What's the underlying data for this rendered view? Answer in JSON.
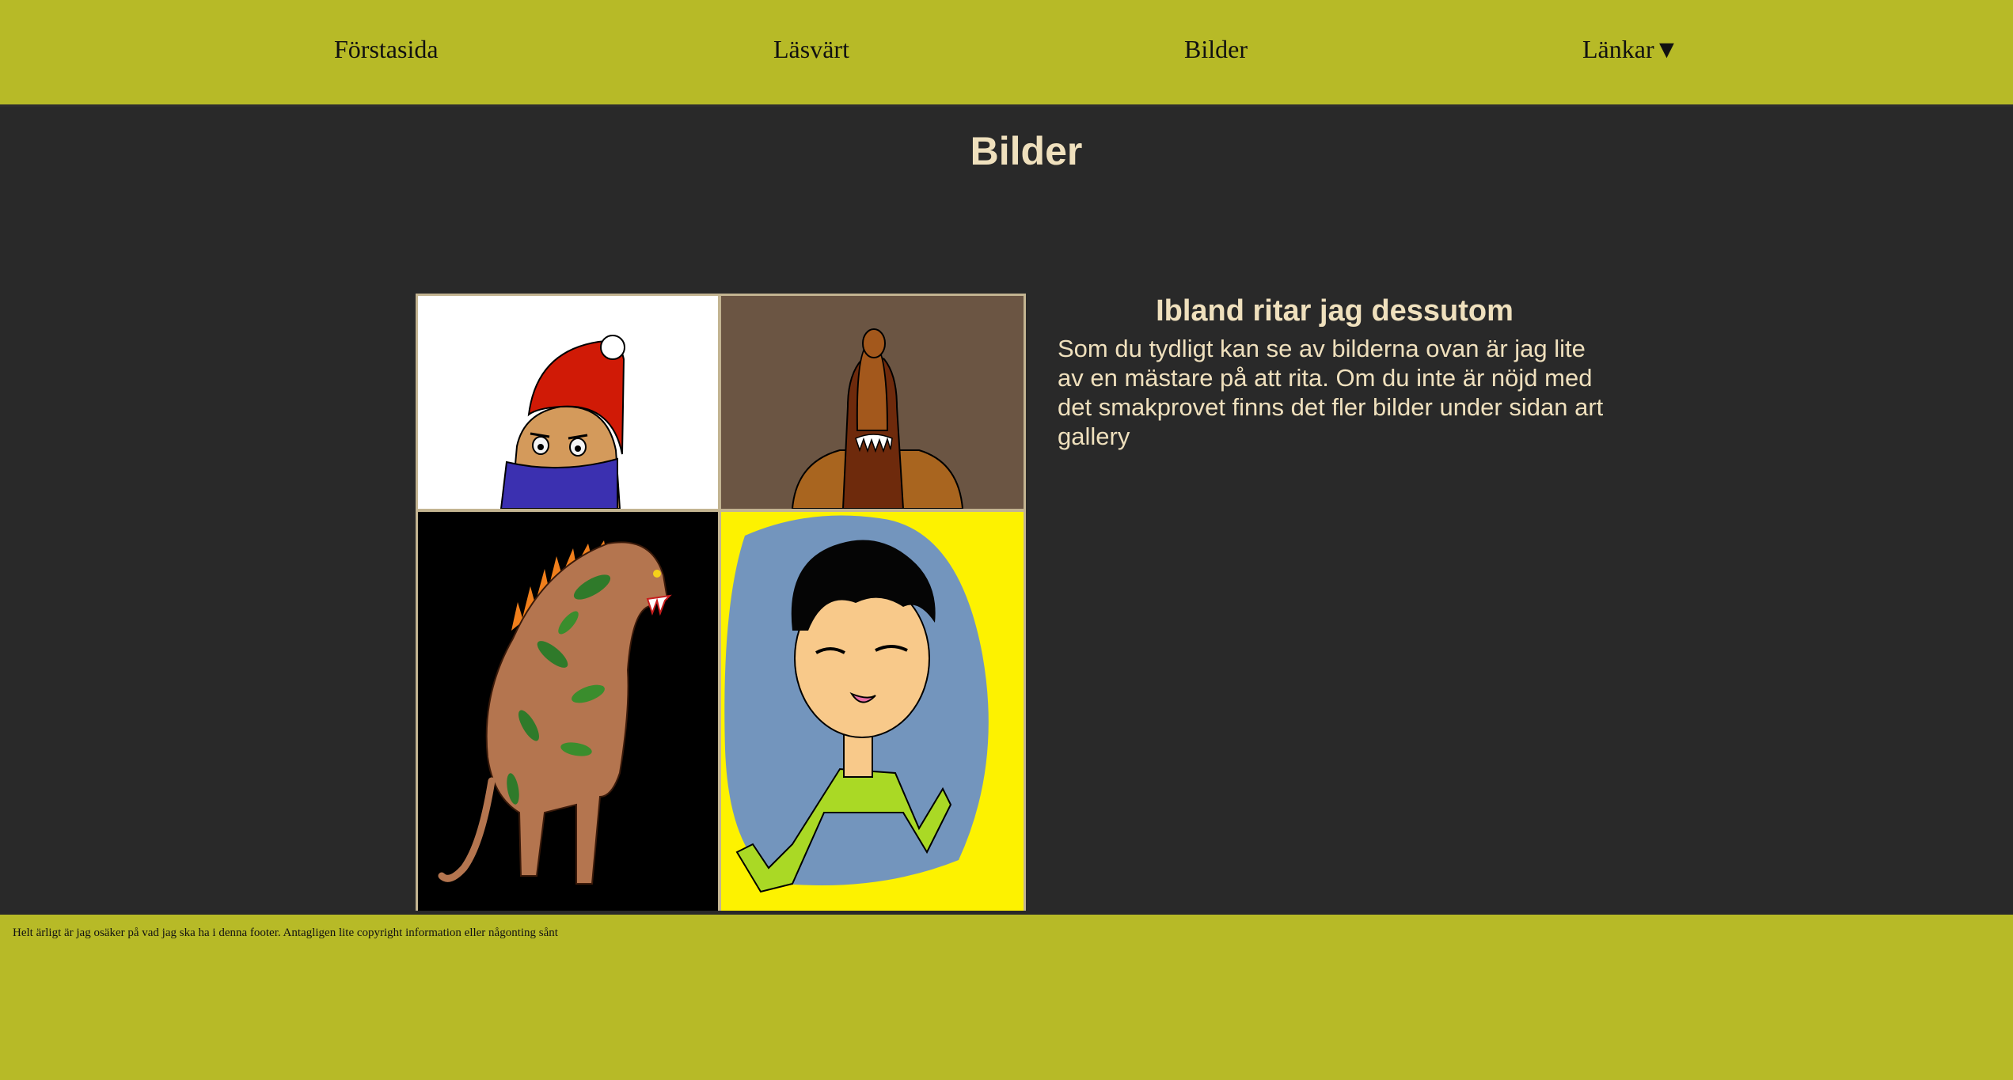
{
  "nav": {
    "items": [
      {
        "label": "Förstasida"
      },
      {
        "label": "Läsvärt"
      },
      {
        "label": "Bilder"
      },
      {
        "label": "Länkar"
      }
    ],
    "dropdown_indicator": "▼"
  },
  "main": {
    "title": "Bilder",
    "aside": {
      "heading": "Ibland ritar jag dessutom",
      "text": "Som du tydligt kan se av bilderna ovan är jag lite av en mästare på att rita. Om du inte är nöjd med det smakprovet finns det fler bilder under sidan art gallery"
    },
    "gallery": {
      "images": [
        {
          "name": "gnome-drawing",
          "background": "#ffffff"
        },
        {
          "name": "monster-drawing",
          "background": "#6b5543"
        },
        {
          "name": "dinosaur-drawing",
          "background": "#000000"
        },
        {
          "name": "boy-drawing",
          "background": "#fdf200"
        }
      ]
    }
  },
  "footer": {
    "text": "Helt ärligt är jag osäker på vad jag ska ha i denna footer. Antagligen lite copyright information eller någonting sånt"
  },
  "colors": {
    "bar": "#b7ba27",
    "page_background": "#292929",
    "heading_text": "#efe0bd"
  }
}
